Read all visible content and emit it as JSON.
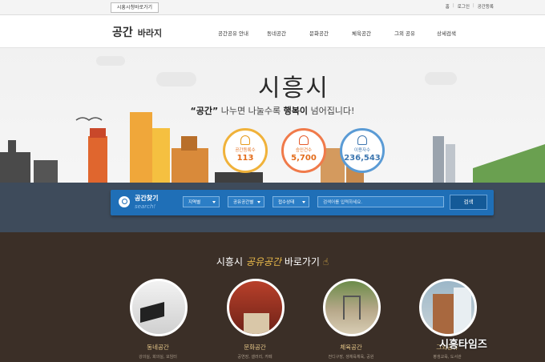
{
  "topbar": {
    "gov_link": "시흥시청바로가기",
    "util": [
      "홈",
      "로그인",
      "공간등록"
    ]
  },
  "header": {
    "logo_main": "공간",
    "logo_sub": "바라지",
    "nav": [
      "공간공유 안내",
      "동네공간",
      "문화공간",
      "체육공간",
      "그외 공유",
      "상세검색"
    ]
  },
  "hero": {
    "city": "시흥시",
    "slogan_prefix": "“공간”",
    "slogan_mid": " 나누면 나눌수록 ",
    "slogan_bold": "행복이",
    "slogan_suffix": " 넘어집니다!",
    "stats": [
      {
        "label": "공간등록수",
        "value": "113"
      },
      {
        "label": "승인건수",
        "value": "5,700"
      },
      {
        "label": "이용자수",
        "value": "236,543"
      }
    ]
  },
  "search": {
    "title": "공간찾기",
    "subtitle": "search!",
    "filters": [
      "지역별",
      "공유공간별",
      "접수상태"
    ],
    "keyword_placeholder": "검색어를 입력하세요.",
    "button": "검색"
  },
  "lower": {
    "title_prefix": "시흥시",
    "title_highlight": "공유공간",
    "title_suffix": "바로가기",
    "categories": [
      {
        "name": "동네공간",
        "desc": "강의실, 회의실, 모임터"
      },
      {
        "name": "문화공간",
        "desc": "공연장, 갤러리, 카페"
      },
      {
        "name": "체육공간",
        "desc": "전디구장, 생체육체육, 공원"
      },
      {
        "name": "그외공유",
        "desc": "평생교육, 도서관"
      }
    ]
  },
  "watermark": "시흥타임즈",
  "colors": {
    "search_bar": "#1f6fb7",
    "lower_bg": "#3b2f27",
    "accent_orange": "#e36c1b",
    "accent_blue": "#3e77b0"
  }
}
